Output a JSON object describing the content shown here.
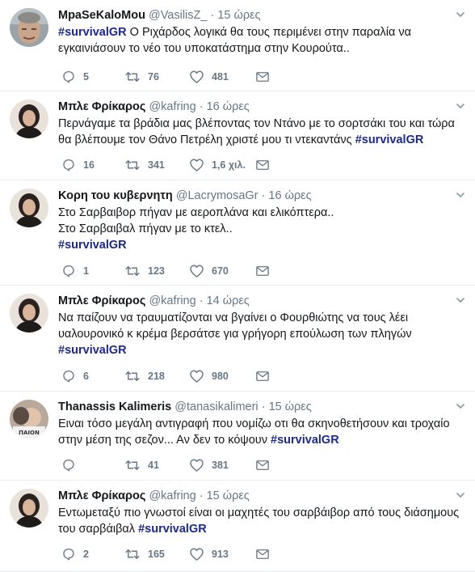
{
  "tweets": [
    {
      "name": "MpaSeKaloMou",
      "handle": "@VasilisZ_",
      "dot": "·",
      "time": "15 ώρες",
      "lines": [
        [
          "#survivalGR",
          " Ο Ριχάρδος λογικά θα τους περιμένει στην παραλία να"
        ],
        [
          "",
          "εγκαινιάσουν το νέο του υποκατάστημα στην Κουρούτα.."
        ]
      ],
      "replies": "5",
      "retweets": "76",
      "likes": "481",
      "avatar_icon": "profile-photo-man-icon"
    },
    {
      "name": "Μπλε Φρίκαρος",
      "handle": "@kafring",
      "dot": "·",
      "time": "16 ώρες",
      "lines": [
        [
          "",
          "Περνάγαμε τα βράδια μας βλέποντας τον Ντάνο με το σορτσάκι του και τώρα"
        ],
        [
          "",
          "θα βλέπουμε τον Θάνο Πετρέλη χριστέ μου τι ντεκαντάνς ",
          "#survivalGR"
        ]
      ],
      "replies": "16",
      "retweets": "341",
      "likes": "1,6 χιλ.",
      "avatar_icon": "profile-photo-woman-icon"
    },
    {
      "name": "Κορη του κυβερνητη",
      "handle": "@LacrymosaGr",
      "dot": "·",
      "time": "16 ώρες",
      "lines": [
        [
          "",
          "Στο Σαρβαιβορ πήγαν με αεροπλάνα και ελικόπτερα.."
        ],
        [
          "",
          "Στο Σαρβαιβαλ πήγαν με το κτελ.."
        ],
        [
          "#survivalGR",
          ""
        ]
      ],
      "replies": "1",
      "retweets": "123",
      "likes": "670",
      "avatar_icon": "profile-photo-woman-icon"
    },
    {
      "name": "Μπλε Φρίκαρος",
      "handle": "@kafring",
      "dot": "·",
      "time": "14 ώρες",
      "lines": [
        [
          "",
          "Να παίζουν να τραυματίζονται να βγαίνει ο Φουρθιώτης να τους λέει"
        ],
        [
          "",
          "υαλουρονικό κ κρέμα βερσάτσε για γρήγορη επούλωση των πληγών"
        ],
        [
          "#survivalGR",
          ""
        ]
      ],
      "replies": "6",
      "retweets": "218",
      "likes": "980",
      "avatar_icon": "profile-photo-woman-icon"
    },
    {
      "name": "Thanassis Kalimeris",
      "handle": "@tanasikalimeri",
      "dot": "·",
      "time": "15 ώρες",
      "lines": [
        [
          "",
          "Ειναι τόσο μεγάλη αντιγραφή που νομίζω οτι θα σκηνοθετήσουν και τροχαίο"
        ],
        [
          "",
          "στην μέση της σεζον... Αν δεν το κόψουν  ",
          "#survivalGR"
        ]
      ],
      "replies": "",
      "retweets": "41",
      "likes": "381",
      "avatar_icon": "profile-photo-baby-icon",
      "avatar_caption": "ΠΑΙΟΝ"
    },
    {
      "name": "Μπλε Φρίκαρος",
      "handle": "@kafring",
      "dot": "·",
      "time": "15 ώρες",
      "lines": [
        [
          "",
          "Εντωμεταξύ πιο γνωστοί είναι οι μαχητές του σαρβάιβορ από τους διάσημους"
        ],
        [
          "",
          "του σαρβάιβαλ ",
          "#survivalGR"
        ]
      ],
      "replies": "2",
      "retweets": "165",
      "likes": "913",
      "avatar_icon": "profile-photo-woman-icon"
    }
  ],
  "icons": {
    "reply": "reply-icon",
    "retweet": "retweet-icon",
    "like": "heart-icon",
    "dm": "envelope-icon",
    "menu": "chevron-down-icon"
  },
  "colors": {
    "hashtag": "#1b2a8a",
    "meta": "#657786",
    "divider": "#e6ecf0"
  }
}
